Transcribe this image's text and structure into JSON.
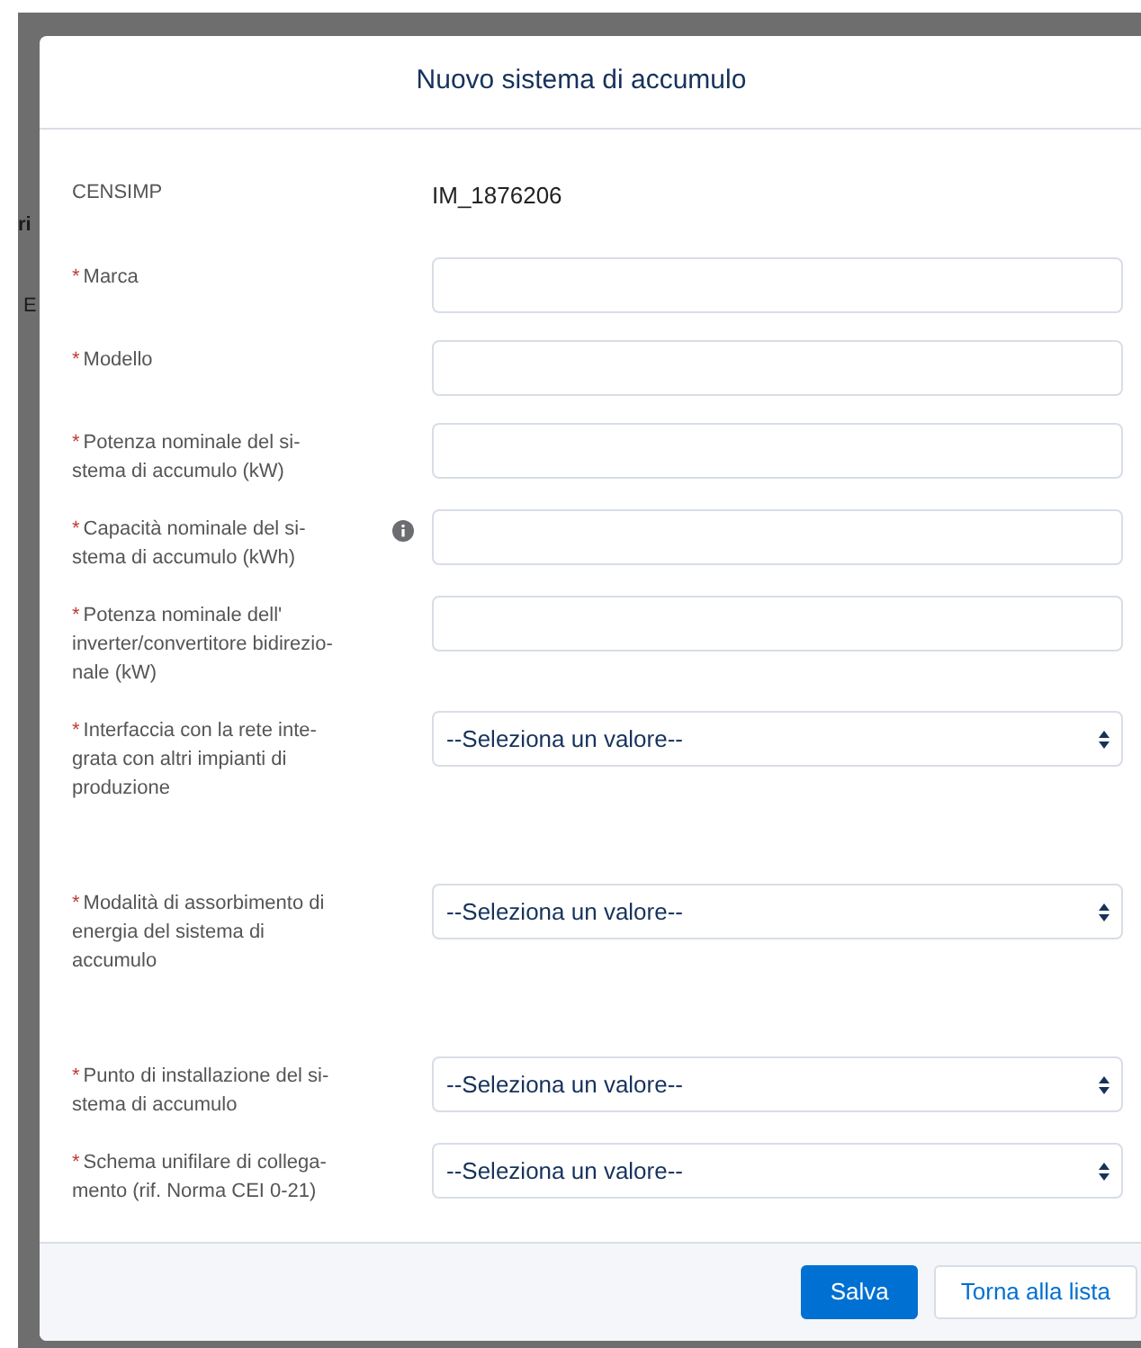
{
  "background": {
    "fragments": [
      "ri",
      "E"
    ]
  },
  "modal": {
    "title": "Nuovo sistema di accumulo",
    "censimp": {
      "label": "CENSIMP",
      "value": "IM_1876206"
    },
    "fields": [
      {
        "kind": "input",
        "required_mark": "*",
        "label": "Marca",
        "info": false
      },
      {
        "kind": "input",
        "required_mark": "*",
        "label": "Modello",
        "info": false
      },
      {
        "kind": "input",
        "required_mark": "*",
        "label": "Potenza nominale del si-\nstema di accumulo (kW)",
        "info": false
      },
      {
        "kind": "input",
        "required_mark": "*",
        "label": "Capacità nominale del si-\nstema di accumulo (kWh)",
        "info": true
      },
      {
        "kind": "input",
        "required_mark": "*",
        "label": "Potenza nominale dell'\ninverter/convertitore bidirezio-\nnale (kW)",
        "info": false
      },
      {
        "kind": "select",
        "required_mark": "*",
        "label": "Interfaccia con la rete inte-\ngrata con altri impianti di\nproduzione",
        "info": false,
        "value": "--Seleziona un valore--"
      },
      {
        "kind": "select",
        "required_mark": "*",
        "label": "Modalità di assorbimento di\nenergia del sistema di\naccumulo",
        "info": false,
        "value": "--Seleziona un valore--"
      },
      {
        "kind": "select",
        "required_mark": "*",
        "label": "Punto di installazione del si-\nstema di accumulo",
        "info": false,
        "value": "--Seleziona un valore--"
      },
      {
        "kind": "select",
        "required_mark": "*",
        "label": "Schema unifilare di collega-\nmento (rif. Norma CEI 0-21)",
        "info": false,
        "value": "--Seleziona un valore--"
      }
    ],
    "buttons": [
      {
        "kind": "primary",
        "label": "Salva"
      },
      {
        "kind": "secondary",
        "label": "Torna alla lista"
      }
    ]
  }
}
